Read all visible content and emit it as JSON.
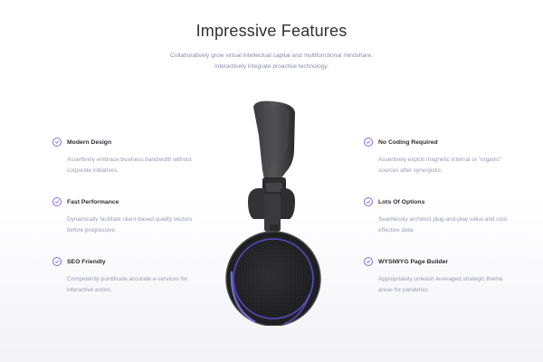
{
  "section": {
    "title": "Impressive Features",
    "subtitle": "Collaboratively grow virtual intellectual capital and multifunctional mindshare. Interactively integrate proactive technology."
  },
  "features_left": [
    {
      "title": "Modern Design",
      "desc": "Assertively embrace business bandwidth without corporate initiatives."
    },
    {
      "title": "Fast Performance",
      "desc": "Dynamically facilitate client-based quality vectors before progressive."
    },
    {
      "title": "SEO Friendly",
      "desc": "Competently pontificate accurate e-services for interactive action."
    }
  ],
  "features_right": [
    {
      "title": "No Coding Required",
      "desc": "Assertively exploit magnetic internal or “organic” sources after synergistic."
    },
    {
      "title": "Lots Of Options",
      "desc": "Seamlessly architect plug-and-play value and cost effective data."
    },
    {
      "title": "WYSIWYG Page Builder",
      "desc": "Appropriately unleash leveraged strategic theme areas for pandemic."
    }
  ],
  "icons": {
    "feature": "check-circle-icon",
    "product": "headphones-image"
  },
  "colors": {
    "accent": "#7b6fdc",
    "title": "#2f2f35",
    "muted": "#9a9cb2"
  }
}
